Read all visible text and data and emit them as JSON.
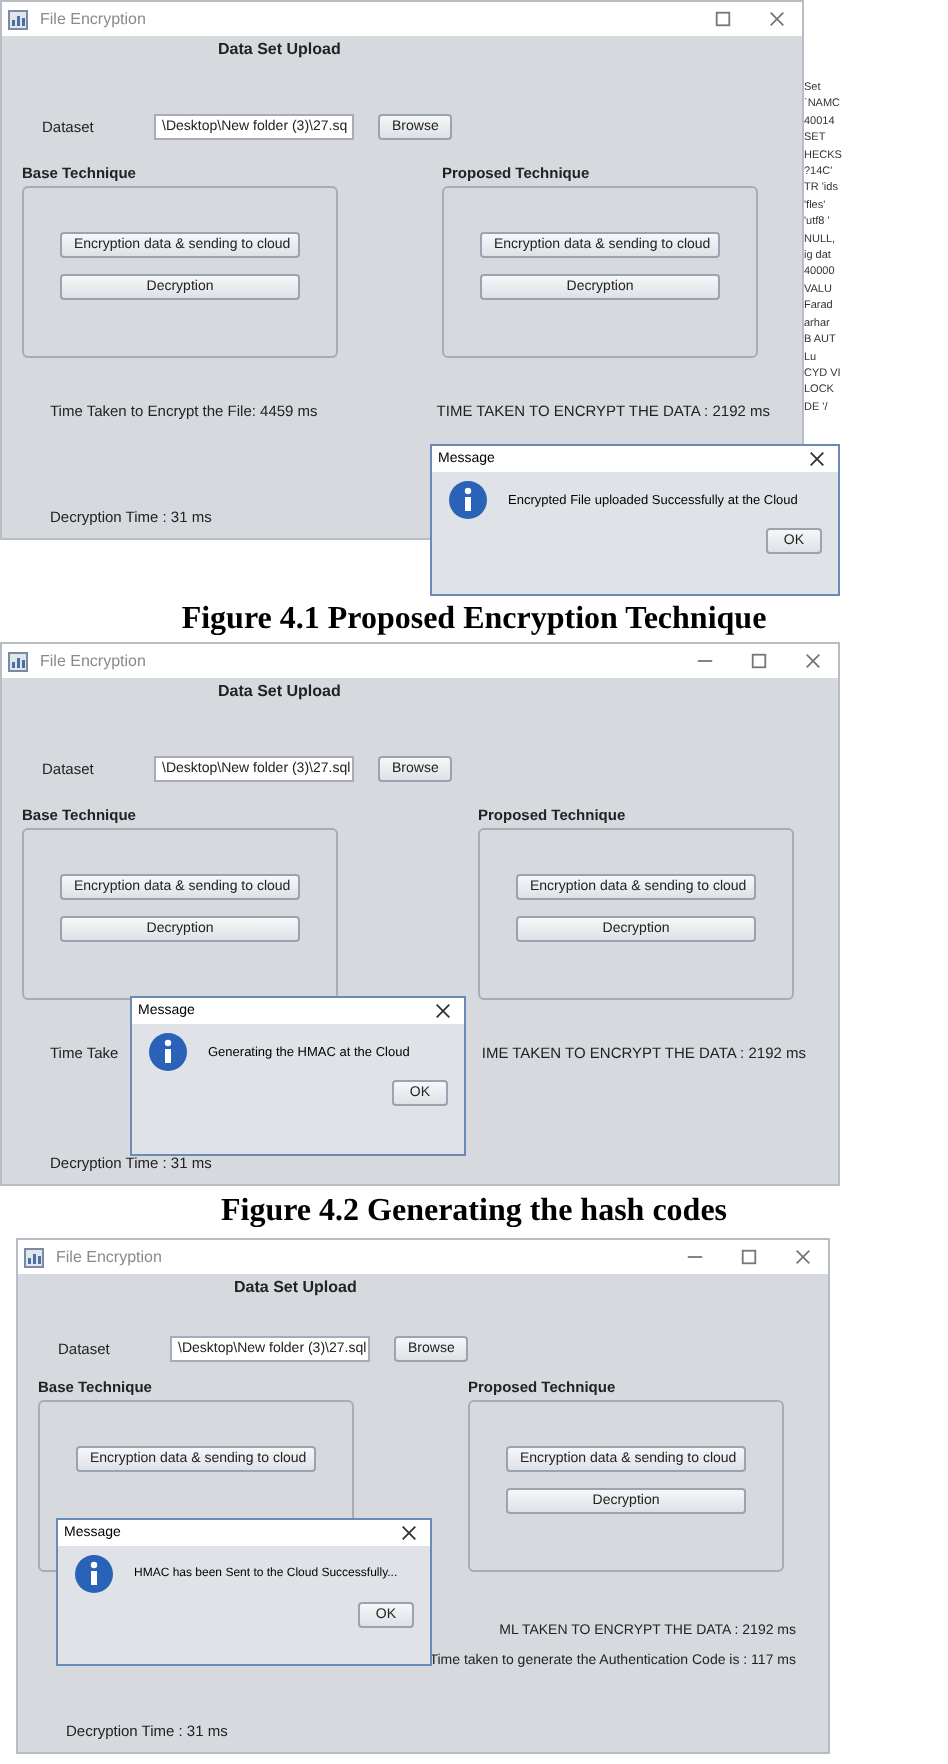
{
  "figures": [
    {
      "window": {
        "title": "File Encryption",
        "minimize_button": false,
        "heading": "Data Set Upload",
        "dataset_label": "Dataset",
        "dataset_value": "\\Desktop\\New folder (3)\\27.sq",
        "browse": "Browse",
        "base": {
          "title": "Base Technique",
          "encrypt_button": "Encryption data & sending to cloud",
          "decrypt_button": "Decryption"
        },
        "proposed": {
          "title": "Proposed Technique",
          "encrypt_button": "Encryption data & sending to cloud",
          "decrypt_button": "Decryption"
        },
        "left_time": "Time Taken to Encrypt the File: 4459 ms",
        "right_time": "TIME TAKEN TO ENCRYPT THE DATA : 2192 ms",
        "decryption_time": "Decryption Time : 31 ms"
      },
      "side_text": [
        "Set",
        "`NAMC",
        "40014",
        "SET",
        "HECKS",
        "?14C'",
        "TR 'ids",
        "'fles'",
        "'utf8 '",
        "NULL,",
        "ig dat",
        "40000",
        "VALU",
        "Farad",
        "arhar",
        "B AUT",
        "Lu",
        "CYD VI",
        "LOCK",
        "DE '/"
      ],
      "dialog": {
        "title": "Message",
        "message": "Encrypted File uploaded Successfully at the Cloud",
        "ok": "OK"
      },
      "caption": "Figure 4.1 Proposed Encryption Technique"
    },
    {
      "window": {
        "title": "File Encryption",
        "minimize_button": true,
        "heading": "Data Set Upload",
        "dataset_label": "Dataset",
        "dataset_value": "\\Desktop\\New folder (3)\\27.sql",
        "browse": "Browse",
        "base": {
          "title": "Base Technique",
          "encrypt_button": "Encryption data & sending to cloud",
          "decrypt_button": "Decryption"
        },
        "proposed": {
          "title": "Proposed Technique",
          "encrypt_button": "Encryption data & sending to cloud",
          "decrypt_button": "Decryption"
        },
        "left_time": "Time Take",
        "right_time": "IME TAKEN TO ENCRYPT THE DATA : 2192 ms",
        "decryption_time": "Decryption Time : 31 ms"
      },
      "dialog": {
        "title": "Message",
        "message": "Generating the HMAC at the Cloud",
        "ok": "OK"
      },
      "caption": "Figure 4.2 Generating the hash codes"
    },
    {
      "window": {
        "title": "File Encryption",
        "minimize_button": true,
        "heading": "Data Set Upload",
        "dataset_label": "Dataset",
        "dataset_value": "\\Desktop\\New folder (3)\\27.sql",
        "browse": "Browse",
        "base": {
          "title": "Base Technique",
          "encrypt_button": "Encryption data & sending to cloud"
        },
        "proposed": {
          "title": "Proposed Technique",
          "encrypt_button": "Encryption data & sending to cloud",
          "decrypt_button": "Decryption"
        },
        "right_time": "ML TAKEN TO ENCRYPT THE DATA : 2192 ms",
        "auth_time": "Time taken to generate the Authentication Code is : 117 ms",
        "decryption_time": "Decryption Time : 31 ms"
      },
      "dialog": {
        "title": "Message",
        "message": "HMAC has been Sent to the Cloud Successfully...",
        "ok": "OK"
      }
    }
  ]
}
